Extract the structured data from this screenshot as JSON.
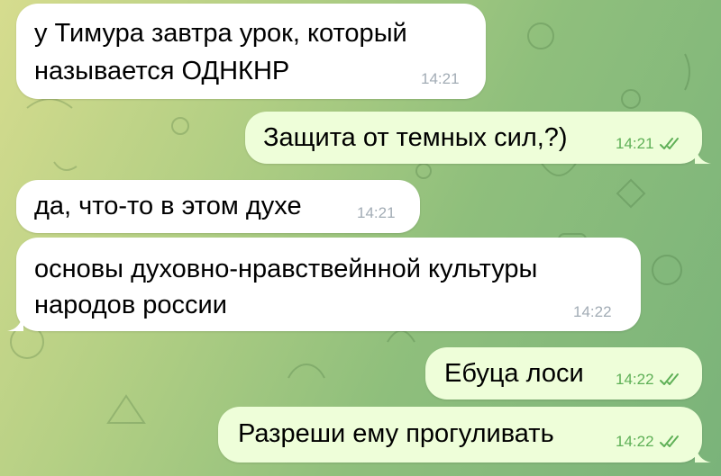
{
  "chat": {
    "messages": [
      {
        "direction": "in",
        "lines": [
          "у Тимура завтра урок, который",
          "называется ОДНКНР"
        ],
        "time": "14:21"
      },
      {
        "direction": "out",
        "lines": [
          "Защита от темных сил,?)"
        ],
        "time": "14:21",
        "status": "read"
      },
      {
        "direction": "in",
        "lines": [
          "да, что-то в этом духе"
        ],
        "time": "14:21"
      },
      {
        "direction": "in",
        "lines": [
          "основы духовно-нравствейнной культуры",
          "народов россии"
        ],
        "time": "14:22"
      },
      {
        "direction": "out",
        "lines": [
          "Ебуца лоси"
        ],
        "time": "14:22",
        "status": "read"
      },
      {
        "direction": "out",
        "lines": [
          "Разреши ему прогуливать"
        ],
        "time": "14:22",
        "status": "read"
      }
    ]
  },
  "colors": {
    "incoming_bubble": "#ffffff",
    "outgoing_bubble": "#eefed9",
    "outgoing_time": "#5fb057",
    "incoming_time": "#a2acb5"
  },
  "icons": {
    "read_status": "double-check-icon"
  }
}
